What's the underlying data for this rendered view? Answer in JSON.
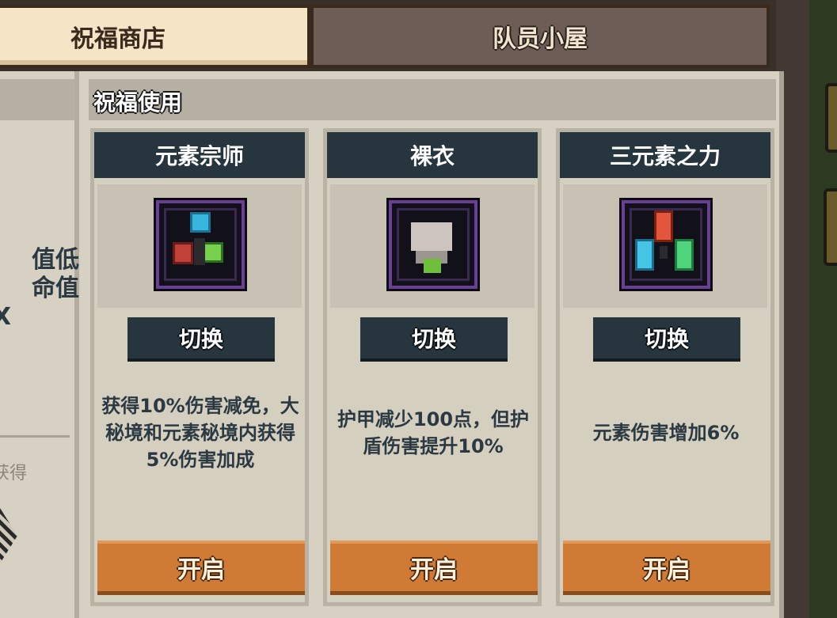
{
  "tabs": [
    {
      "label": "祝福商店",
      "active": true
    },
    {
      "label": "队员小屋",
      "active": false
    }
  ],
  "left_panel": {
    "lines": [
      "值低",
      "命值",
      "X"
    ],
    "small_text": "获得"
  },
  "section": {
    "title": "祝福使用"
  },
  "cards": [
    {
      "title": "元素宗师",
      "icon": "element-master-icon",
      "switch_label": "切换",
      "description": "获得10%伤害减免，大秘境和元素秘境内获得5%伤害加成",
      "open_label": "开启"
    },
    {
      "title": "裸衣",
      "icon": "bare-clothes-icon",
      "switch_label": "切换",
      "description": "护甲减少100点，但护盾伤害提升10%",
      "open_label": "开启"
    },
    {
      "title": "三元素之力",
      "icon": "three-elements-icon",
      "switch_label": "切换",
      "description": "元素伤害增加6%",
      "open_label": "开启"
    }
  ],
  "colors": {
    "header_dark": "#26353e",
    "open_button": "#cf7b35",
    "panel_bg": "#d7d1c3",
    "active_tab": "#f5e5c6",
    "inactive_tab": "#6e5d56"
  }
}
